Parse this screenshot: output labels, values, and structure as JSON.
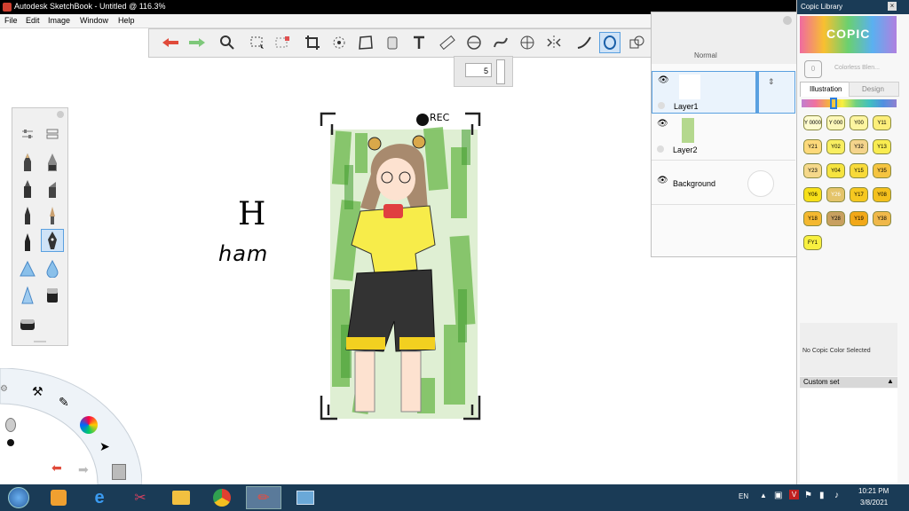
{
  "window": {
    "title": "Autodesk SketchBook - Untitled @ 116.3%"
  },
  "menu": [
    "File",
    "Edit",
    "Image",
    "Window",
    "Help"
  ],
  "toolbar": {
    "tools": [
      "undo",
      "redo",
      "zoom",
      "select",
      "crop-select",
      "crop",
      "transform",
      "distort",
      "fill",
      "text",
      "ruler",
      "ellipse",
      "french-curve",
      "perspective",
      "symmetry",
      "stroke",
      "ellipse-active",
      "shape",
      "copy",
      "brush",
      "color",
      "palette"
    ]
  },
  "brush_size": {
    "value": "5"
  },
  "canvas": {
    "text_h": "H",
    "text_ham": "ham",
    "rec_label": "REC"
  },
  "layers": {
    "items": [
      {
        "name": "Layer1"
      },
      {
        "name": "Layer2"
      },
      {
        "name": "Background"
      }
    ],
    "blend_mode": "Normal"
  },
  "copic": {
    "title": "Copic Library",
    "logo": "COPIC",
    "colorless": "Colorless Blen...",
    "colorless_code": "0",
    "tabs": [
      "Illustration",
      "Design"
    ],
    "swatches": [
      {
        "code": "Y 0000",
        "color": "#fdfbd0"
      },
      {
        "code": "Y 000",
        "color": "#fcf7b8"
      },
      {
        "code": "Y00",
        "color": "#fdf5a0"
      },
      {
        "code": "Y11",
        "color": "#fcee7a"
      },
      {
        "code": "Y21",
        "color": "#fdd97a"
      },
      {
        "code": "Y02",
        "color": "#f8ee60"
      },
      {
        "code": "Y32",
        "color": "#f4d48c"
      },
      {
        "code": "Y13",
        "color": "#f9ec50"
      },
      {
        "code": "Y23",
        "color": "#f5d88a"
      },
      {
        "code": "Y04",
        "color": "#f6e440"
      },
      {
        "code": "Y15",
        "color": "#f8da3a"
      },
      {
        "code": "Y35",
        "color": "#f5c440"
      },
      {
        "code": "Y06",
        "color": "#f7e018"
      },
      {
        "code": "Y26",
        "color": "#e4c46a"
      },
      {
        "code": "Y17",
        "color": "#f6c820"
      },
      {
        "code": "Y08",
        "color": "#f4c01c"
      },
      {
        "code": "Y18",
        "color": "#f4b830"
      },
      {
        "code": "Y28",
        "color": "#c8a060"
      },
      {
        "code": "Y19",
        "color": "#f2a818"
      },
      {
        "code": "Y38",
        "color": "#f0b84a"
      },
      {
        "code": "FY1",
        "color": "#f8f040"
      }
    ],
    "status": "No Copic Color Selected",
    "custom_set": "Custom set"
  },
  "taskbar": {
    "lang": "EN",
    "time": "10:21 PM",
    "date": "3/8/2021"
  },
  "colors": {
    "accent": "#5aa0e0",
    "taskbar": "#1a3b56"
  }
}
